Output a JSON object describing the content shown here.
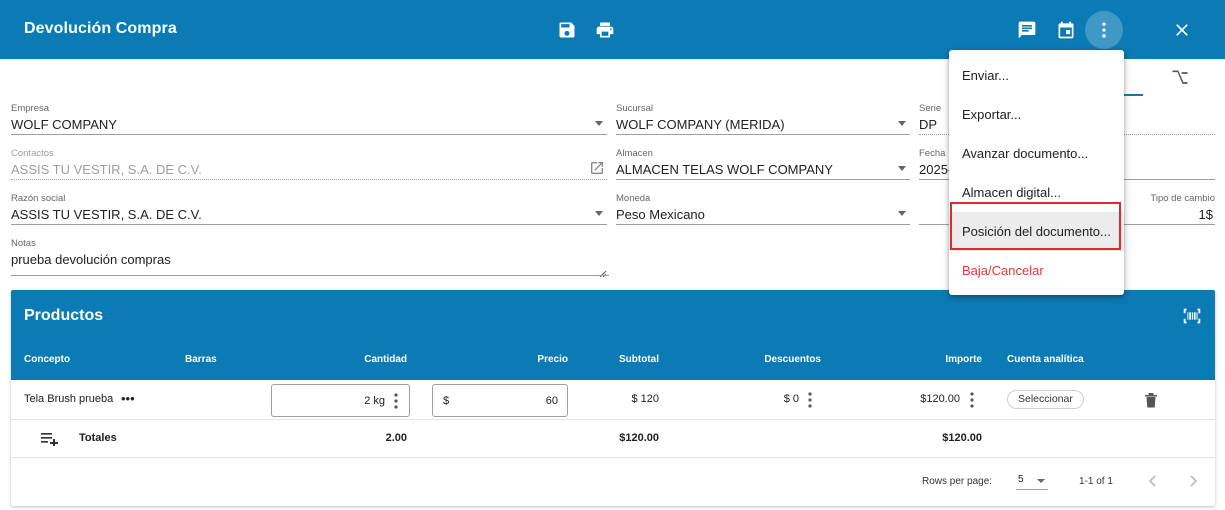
{
  "appbar": {
    "title": "Devolución Compra"
  },
  "form": {
    "empresa": {
      "label": "Empresa",
      "value": "WOLF COMPANY"
    },
    "sucursal": {
      "label": "Sucursal",
      "value": "WOLF COMPANY (MERIDA)"
    },
    "serie": {
      "label": "Serie",
      "value": "DP"
    },
    "contactos": {
      "label": "Contactos",
      "value": "ASSIS TU VESTIR, S.A. DE C.V."
    },
    "almacen": {
      "label": "Almacen",
      "value": "ALMACEN TELAS WOLF COMPANY"
    },
    "fecha": {
      "label": "Fecha",
      "value": "2025-"
    },
    "razon_social": {
      "label": "Razón social",
      "value": "ASSIS TU VESTIR, S.A. DE C.V."
    },
    "moneda": {
      "label": "Moneda",
      "value": "Peso Mexicano"
    },
    "tipo_cambio": {
      "label": "Tipo de cambio",
      "value": "1$"
    },
    "notas": {
      "label": "Notas",
      "value": "prueba devolución compras"
    }
  },
  "productos": {
    "title": "Productos",
    "columns": [
      "Concepto",
      "Barras",
      "Cantidad",
      "Precio",
      "Subtotal",
      "Descuentos",
      "Importe",
      "Cuenta analítica"
    ],
    "rows": [
      {
        "concepto": "Tela Brush prueba",
        "more": "•••",
        "cantidad": "2 kg",
        "precio_symbol": "$",
        "precio": "60",
        "subtotal": "$ 120",
        "descuentos": "$ 0",
        "importe": "$120.00",
        "cuenta_btn": "Seleccionar"
      }
    ],
    "totals": {
      "label": "Totales",
      "cantidad": "2.00",
      "subtotal": "$120.00",
      "importe": "$120.00"
    },
    "pagination": {
      "rows_per_page_label": "Rows per page:",
      "rows_per_page": "5",
      "range": "1-1 of 1"
    }
  },
  "menu": {
    "items": [
      {
        "label": "Enviar..."
      },
      {
        "label": "Exportar..."
      },
      {
        "label": "Avanzar documento..."
      },
      {
        "label": "Almacen digital..."
      },
      {
        "label": "Posición del documento..."
      },
      {
        "label": "Baja/Cancelar"
      }
    ]
  },
  "colors": {
    "primary": "#0a7bb5",
    "danger": "#e53935",
    "highlight_border": "#e0292b"
  }
}
